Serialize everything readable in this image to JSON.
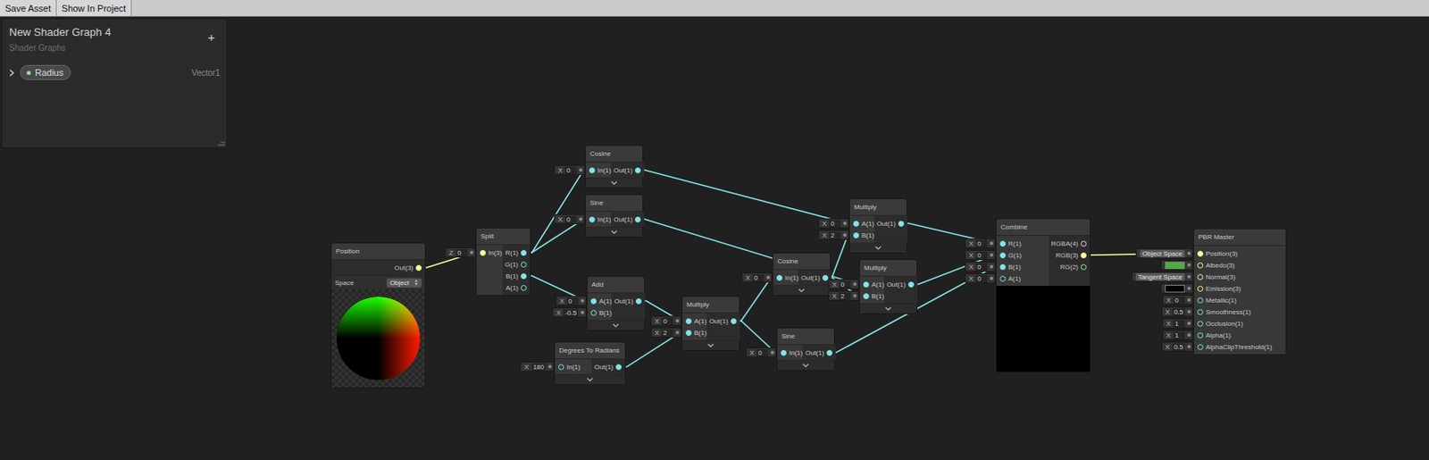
{
  "toolbar": {
    "buttons": [
      {
        "label": "Save Asset"
      },
      {
        "label": "Show In Project"
      }
    ]
  },
  "blackboard": {
    "title": "New Shader Graph 4",
    "subtitle": "Shader Graphs",
    "add_button": "+",
    "properties": [
      {
        "name": "Radius",
        "type": "Vector1",
        "expanded": false
      }
    ]
  },
  "nodes": [
    {
      "title": "Position",
      "inputs": [],
      "outputs": [
        {
          "label": "Out(3)",
          "connected": true
        }
      ],
      "settings": [
        {
          "label": "Space",
          "value": "Object"
        }
      ],
      "preview": {
        "kind": "position"
      },
      "expander": false
    },
    {
      "title": "Split",
      "inputs": [
        {
          "label": "In(3)",
          "connected": true,
          "field": {
            "axis": "Z",
            "value": "0"
          }
        }
      ],
      "outputs": [
        {
          "label": "R(1)",
          "connected": true
        },
        {
          "label": "G(1)",
          "connected": false
        },
        {
          "label": "B(1)",
          "connected": true
        },
        {
          "label": "A(1)",
          "connected": false
        }
      ],
      "expander": false
    },
    {
      "title": "Cosine",
      "inputs": [
        {
          "label": "In(1)",
          "connected": true,
          "field": {
            "axis": "X",
            "value": "0"
          }
        }
      ],
      "outputs": [
        {
          "label": "Out(1)",
          "connected": true
        }
      ],
      "expander": true
    },
    {
      "title": "Sine",
      "inputs": [
        {
          "label": "In(1)",
          "connected": true,
          "field": {
            "axis": "X",
            "value": "0"
          }
        }
      ],
      "outputs": [
        {
          "label": "Out(1)",
          "connected": true
        }
      ],
      "expander": true
    },
    {
      "title": "Add",
      "inputs": [
        {
          "label": "A(1)",
          "connected": true,
          "field": {
            "axis": "X",
            "value": "0"
          }
        },
        {
          "label": "B(1)",
          "connected": false,
          "field": {
            "axis": "X",
            "value": "-0.5"
          }
        }
      ],
      "outputs": [
        {
          "label": "Out(1)",
          "connected": true
        }
      ],
      "expander": true
    },
    {
      "title": "Degrees To Radians",
      "inputs": [
        {
          "label": "In(1)",
          "connected": false,
          "field": {
            "axis": "X",
            "value": "180"
          }
        }
      ],
      "outputs": [
        {
          "label": "Out(1)",
          "connected": true
        }
      ],
      "expander": true
    },
    {
      "title": "Multiply",
      "inputs": [
        {
          "label": "A(1)",
          "connected": true,
          "field": {
            "axis": "X",
            "value": "0"
          }
        },
        {
          "label": "B(1)",
          "connected": true,
          "field": {
            "axis": "X",
            "value": "2"
          }
        }
      ],
      "outputs": [
        {
          "label": "Out(1)",
          "connected": true
        }
      ],
      "expander": true
    },
    {
      "title": "Cosine",
      "inputs": [
        {
          "label": "In(1)",
          "connected": true,
          "field": {
            "axis": "X",
            "value": "0"
          }
        }
      ],
      "outputs": [
        {
          "label": "Out(1)",
          "connected": true
        }
      ],
      "expander": true
    },
    {
      "title": "Sine",
      "inputs": [
        {
          "label": "In(1)",
          "connected": true,
          "field": {
            "axis": "X",
            "value": "0"
          }
        }
      ],
      "outputs": [
        {
          "label": "Out(1)",
          "connected": true
        }
      ],
      "expander": true
    },
    {
      "title": "Multiply",
      "inputs": [
        {
          "label": "A(1)",
          "connected": true,
          "field": {
            "axis": "X",
            "value": "0"
          }
        },
        {
          "label": "B(1)",
          "connected": true,
          "field": {
            "axis": "X",
            "value": "2"
          }
        }
      ],
      "outputs": [
        {
          "label": "Out(1)",
          "connected": true
        }
      ],
      "expander": true
    },
    {
      "title": "Multiply",
      "inputs": [
        {
          "label": "A(1)",
          "connected": true,
          "field": {
            "axis": "X",
            "value": "0"
          }
        },
        {
          "label": "B(1)",
          "connected": true,
          "field": {
            "axis": "X",
            "value": "2"
          }
        }
      ],
      "outputs": [
        {
          "label": "Out(1)",
          "connected": true
        }
      ],
      "expander": true
    },
    {
      "title": "Combine",
      "inputs": [
        {
          "label": "R(1)",
          "connected": true,
          "field": {
            "axis": "X",
            "value": "0"
          }
        },
        {
          "label": "G(1)",
          "connected": true,
          "field": {
            "axis": "X",
            "value": "0"
          }
        },
        {
          "label": "B(1)",
          "connected": true,
          "field": {
            "axis": "X",
            "value": "0"
          }
        },
        {
          "label": "A(1)",
          "connected": false,
          "field": {
            "axis": "X",
            "value": "0"
          }
        }
      ],
      "outputs": [
        {
          "label": "RGBA(4)",
          "connected": false
        },
        {
          "label": "RGB(3)",
          "connected": true
        },
        {
          "label": "RG(2)",
          "connected": false
        }
      ],
      "preview": {
        "kind": "solid",
        "color": "#000000"
      },
      "expander": false
    },
    {
      "title": "PBR Master",
      "inputs": [
        {
          "label": "Position(3)",
          "connected": true,
          "field": {
            "value": "Object Space"
          }
        },
        {
          "label": "Albedo(3)",
          "connected": false,
          "field": {
            "swatch": "#4caf3f"
          }
        },
        {
          "label": "Normal(3)",
          "connected": false,
          "field": {
            "value": "Tangent Space"
          }
        },
        {
          "label": "Emission(3)",
          "connected": false,
          "field": {
            "swatch": "#000000"
          }
        },
        {
          "label": "Metallic(1)",
          "connected": false,
          "field": {
            "axis": "X",
            "value": "0"
          }
        },
        {
          "label": "Smoothness(1)",
          "connected": false,
          "field": {
            "axis": "X",
            "value": "0.5"
          }
        },
        {
          "label": "Occlusion(1)",
          "connected": false,
          "field": {
            "axis": "X",
            "value": "1"
          }
        },
        {
          "label": "Alpha(1)",
          "connected": false,
          "field": {
            "axis": "X",
            "value": "1"
          }
        },
        {
          "label": "AlphaClipThreshold(1)",
          "connected": false,
          "field": {
            "axis": "X",
            "value": "0.5"
          }
        }
      ],
      "outputs": [],
      "expander": false
    }
  ]
}
